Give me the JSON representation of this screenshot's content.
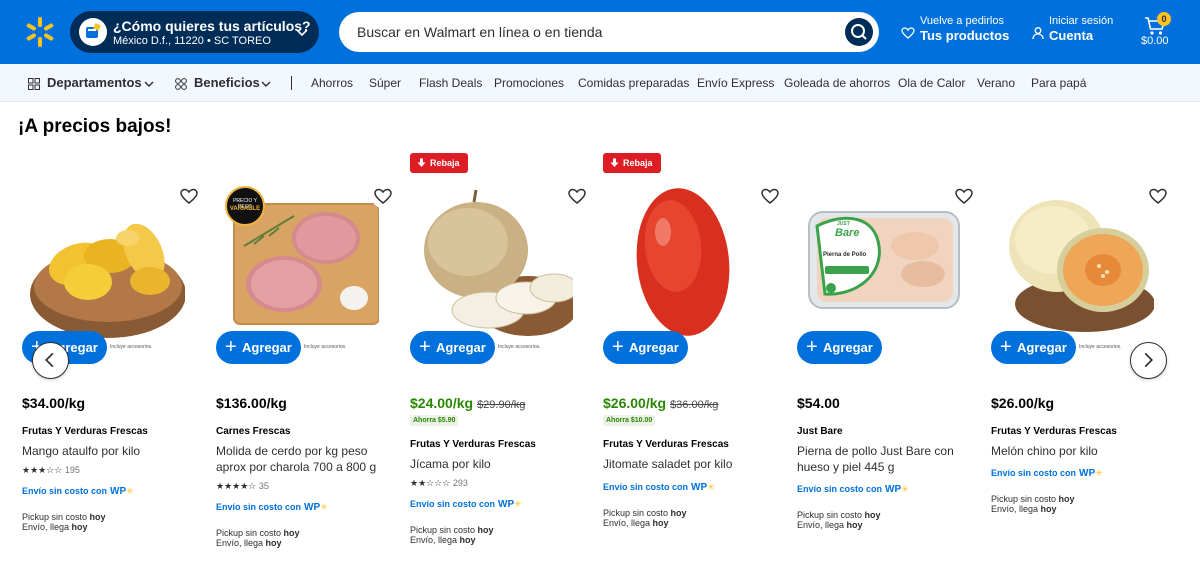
{
  "colors": {
    "brand_blue": "#0071dc",
    "dark_blue": "#002d58",
    "yellow": "#ffc220",
    "green": "#2a8703",
    "red": "#de1c24"
  },
  "header": {
    "location_title": "¿Cómo quieres tus artículos?",
    "location_detail": "México D.f., 11220 • SC TOREO",
    "search_placeholder": "Buscar en Walmart en línea o en tienda",
    "reorder_small": "Vuelve a pedirlos",
    "reorder_big": "Tus productos",
    "account_small": "Iniciar sesión",
    "account_big": "Cuenta",
    "cart_count": "0",
    "cart_total": "$0.00"
  },
  "nav": {
    "departments": "Departamentos",
    "benefits": "Beneficios",
    "links": [
      "Ahorros",
      "Súper",
      "Flash Deals",
      "Promociones",
      "Comidas preparadas",
      "Envío Express",
      "Goleada de ahorros",
      "Ola de Calor",
      "Verano",
      "Para papá"
    ]
  },
  "section_title": "¡A precios bajos!",
  "common": {
    "add_label": "Agregar",
    "rebaja_label": "Rebaja",
    "ship_label": "Envío sin costo con",
    "wp_label": "WP",
    "pickup_label": "Pickup sin costo",
    "delivery_label": "Envío, llega",
    "today": "hoy",
    "accessories_note": "Incluye accesorios."
  },
  "products": [
    {
      "price": "$34.00/kg",
      "old_price": "",
      "savings": "",
      "brand": "Frutas Y Verduras Frescas",
      "name": "Mango ataulfo por kilo",
      "rating_count": "195",
      "stars": "★★★☆☆"
    },
    {
      "price": "$136.00/kg",
      "old_price": "",
      "savings": "",
      "brand": "Carnes Frescas",
      "name": "Molida de cerdo por kg peso aprox por charola 700 a 800 g",
      "rating_count": "35",
      "stars": "★★★★☆",
      "badge_line1": "PRECIO Y PESO",
      "badge_line2": "VARIABLE"
    },
    {
      "price": "$24.00/kg",
      "old_price": "$29.90/kg",
      "savings": "Ahorra $5.90",
      "brand": "Frutas Y Verduras Frescas",
      "name": "Jícama por kilo",
      "rating_count": "293",
      "stars": "★★☆☆☆"
    },
    {
      "price": "$26.00/kg",
      "old_price": "$36.00/kg",
      "savings": "Ahorra $10.00",
      "brand": "Frutas Y Verduras Frescas",
      "name": "Jitomate saladet por kilo",
      "rating_count": "",
      "stars": ""
    },
    {
      "price": "$54.00",
      "old_price": "",
      "savings": "",
      "brand": "Just Bare",
      "name": "Pierna de pollo Just Bare con hueso y piel 445 g",
      "rating_count": "",
      "stars": "",
      "pkg_brand_top": "JUST",
      "pkg_brand": "Bare",
      "pkg_label": "Pierna de Pollo"
    },
    {
      "price": "$26.00/kg",
      "old_price": "",
      "savings": "",
      "brand": "Frutas Y Verduras Frescas",
      "name": "Melón chino por kilo",
      "rating_count": "",
      "stars": ""
    }
  ]
}
